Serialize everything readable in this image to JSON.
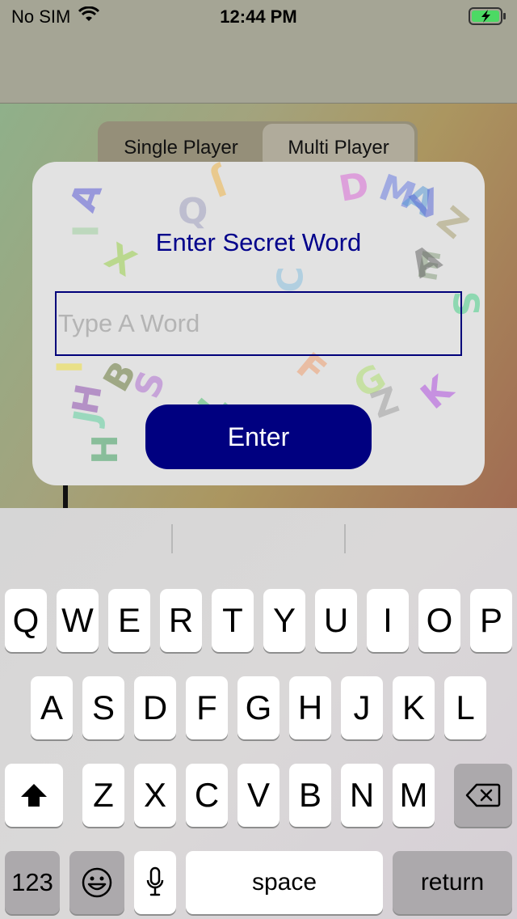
{
  "status_bar": {
    "carrier": "No SIM",
    "time": "12:44 PM",
    "battery": "charging"
  },
  "segmented_control": {
    "single_label": "Single Player",
    "multi_label": "Multi Player",
    "selected": "Multi Player"
  },
  "dialog": {
    "title": "Enter Secret Word",
    "input_placeholder": "Type A Word",
    "input_value": "",
    "button_label": "Enter"
  },
  "background_letters": [
    "A",
    "J",
    "D",
    "M",
    "A",
    "V",
    "Z",
    "X",
    "C",
    "E",
    "A",
    "S",
    "B",
    "S",
    "F",
    "G",
    "Z",
    "K",
    "H",
    "J",
    "I",
    "H",
    "L",
    "I",
    "Q"
  ],
  "keyboard": {
    "row1": [
      "Q",
      "W",
      "E",
      "R",
      "T",
      "Y",
      "U",
      "I",
      "O",
      "P"
    ],
    "row2": [
      "A",
      "S",
      "D",
      "F",
      "G",
      "H",
      "J",
      "K",
      "L"
    ],
    "row3": [
      "Z",
      "X",
      "C",
      "V",
      "B",
      "N",
      "M"
    ],
    "numbers_label": "123",
    "space_label": "space",
    "return_label": "return"
  },
  "colors": {
    "accent": "#000080",
    "title_text": "#00008b"
  }
}
